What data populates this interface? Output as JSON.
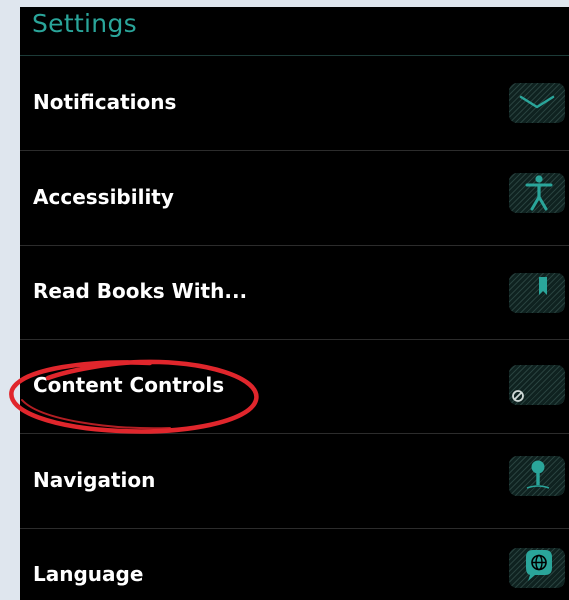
{
  "header": {
    "title": "Settings"
  },
  "items": [
    {
      "label": "Notifications",
      "icon": "chevron-down-icon"
    },
    {
      "label": "Accessibility",
      "icon": "accessibility-icon"
    },
    {
      "label": "Read Books With...",
      "icon": "bookmark-icon"
    },
    {
      "label": "Content Controls",
      "icon": "block-icon"
    },
    {
      "label": "Navigation",
      "icon": "map-pin-icon"
    },
    {
      "label": "Language",
      "icon": "globe-icon"
    }
  ],
  "colors": {
    "background": "#dfe6ee",
    "panel": "#000000",
    "title": "#2aa59a",
    "label": "#ffffff",
    "icon": "#2aa59a",
    "annotation": "#e0262c"
  }
}
